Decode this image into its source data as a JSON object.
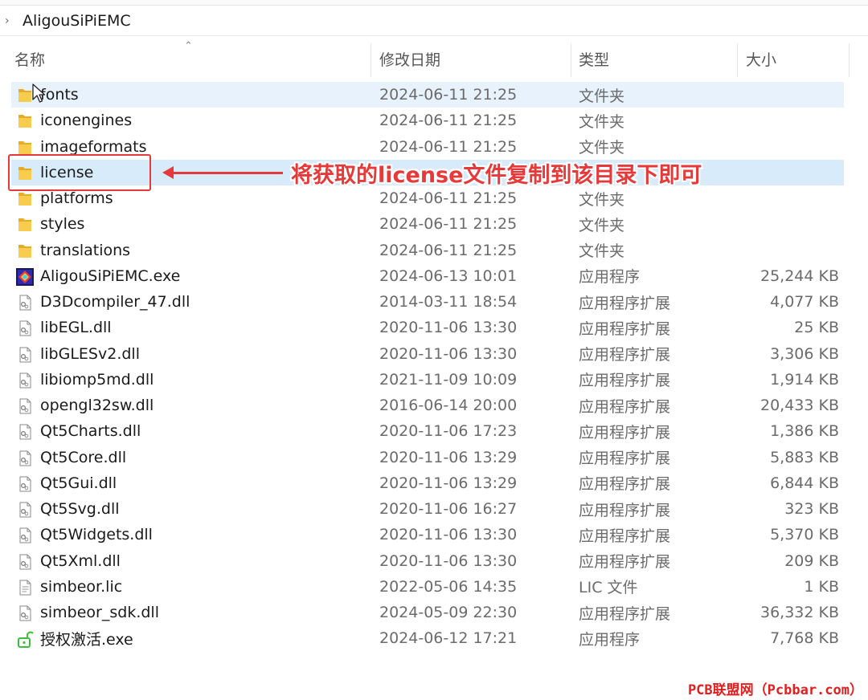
{
  "breadcrumb": {
    "path": "AligouSiPiEMC"
  },
  "columns": {
    "name": "名称",
    "date": "修改日期",
    "type": "类型",
    "size": "大小"
  },
  "files": [
    {
      "name": "fonts",
      "date": "2024-06-11 21:25",
      "type": "文件夹",
      "size": "",
      "icon": "folder-icon",
      "state": "hover"
    },
    {
      "name": "iconengines",
      "date": "2024-06-11 21:25",
      "type": "文件夹",
      "size": "",
      "icon": "folder-icon",
      "state": ""
    },
    {
      "name": "imageformats",
      "date": "2024-06-11 21:25",
      "type": "文件夹",
      "size": "",
      "icon": "folder-icon",
      "state": ""
    },
    {
      "name": "license",
      "date": "",
      "type": "",
      "size": "",
      "icon": "folder-icon",
      "state": "selected"
    },
    {
      "name": "platforms",
      "date": "2024-06-11 21:25",
      "type": "文件夹",
      "size": "",
      "icon": "folder-icon",
      "state": ""
    },
    {
      "name": "styles",
      "date": "2024-06-11 21:25",
      "type": "文件夹",
      "size": "",
      "icon": "folder-icon",
      "state": ""
    },
    {
      "name": "translations",
      "date": "2024-06-11 21:25",
      "type": "文件夹",
      "size": "",
      "icon": "folder-icon",
      "state": ""
    },
    {
      "name": "AligouSiPiEMC.exe",
      "date": "2024-06-13 10:01",
      "type": "应用程序",
      "size": "25,244 KB",
      "icon": "app-exe-icon",
      "state": ""
    },
    {
      "name": "D3Dcompiler_47.dll",
      "date": "2014-03-11 18:54",
      "type": "应用程序扩展",
      "size": "4,077 KB",
      "icon": "dll-icon",
      "state": ""
    },
    {
      "name": "libEGL.dll",
      "date": "2020-11-06 13:30",
      "type": "应用程序扩展",
      "size": "25 KB",
      "icon": "dll-icon",
      "state": ""
    },
    {
      "name": "libGLESv2.dll",
      "date": "2020-11-06 13:30",
      "type": "应用程序扩展",
      "size": "3,306 KB",
      "icon": "dll-icon",
      "state": ""
    },
    {
      "name": "libiomp5md.dll",
      "date": "2021-11-09 10:09",
      "type": "应用程序扩展",
      "size": "1,914 KB",
      "icon": "dll-icon",
      "state": ""
    },
    {
      "name": "opengl32sw.dll",
      "date": "2016-06-14 20:00",
      "type": "应用程序扩展",
      "size": "20,433 KB",
      "icon": "dll-icon",
      "state": ""
    },
    {
      "name": "Qt5Charts.dll",
      "date": "2020-11-06 17:23",
      "type": "应用程序扩展",
      "size": "1,386 KB",
      "icon": "dll-icon",
      "state": ""
    },
    {
      "name": "Qt5Core.dll",
      "date": "2020-11-06 13:29",
      "type": "应用程序扩展",
      "size": "5,883 KB",
      "icon": "dll-icon",
      "state": ""
    },
    {
      "name": "Qt5Gui.dll",
      "date": "2020-11-06 13:29",
      "type": "应用程序扩展",
      "size": "6,844 KB",
      "icon": "dll-icon",
      "state": ""
    },
    {
      "name": "Qt5Svg.dll",
      "date": "2020-11-06 16:27",
      "type": "应用程序扩展",
      "size": "323 KB",
      "icon": "dll-icon",
      "state": ""
    },
    {
      "name": "Qt5Widgets.dll",
      "date": "2020-11-06 13:30",
      "type": "应用程序扩展",
      "size": "5,370 KB",
      "icon": "dll-icon",
      "state": ""
    },
    {
      "name": "Qt5Xml.dll",
      "date": "2020-11-06 13:30",
      "type": "应用程序扩展",
      "size": "209 KB",
      "icon": "dll-icon",
      "state": ""
    },
    {
      "name": "simbeor.lic",
      "date": "2022-05-06 14:35",
      "type": "LIC 文件",
      "size": "1 KB",
      "icon": "text-file-icon",
      "state": ""
    },
    {
      "name": "simbeor_sdk.dll",
      "date": "2024-05-09 22:30",
      "type": "应用程序扩展",
      "size": "36,332 KB",
      "icon": "dll-icon",
      "state": ""
    },
    {
      "name": "授权激活.exe",
      "date": "2024-06-12 17:21",
      "type": "应用程序",
      "size": "7,768 KB",
      "icon": "unlock-exe-icon",
      "state": ""
    }
  ],
  "annotation": {
    "text": "将获取的license文件复制到该目录下即可",
    "color": "#e63a3a"
  },
  "watermark": {
    "text": "PCB联盟网（Pcbbar.com）"
  },
  "colors": {
    "selected_row": "#d8ebfb",
    "hover_row": "#e7f2fc",
    "folder": "#f4c542",
    "annotation": "#e63a3a"
  }
}
